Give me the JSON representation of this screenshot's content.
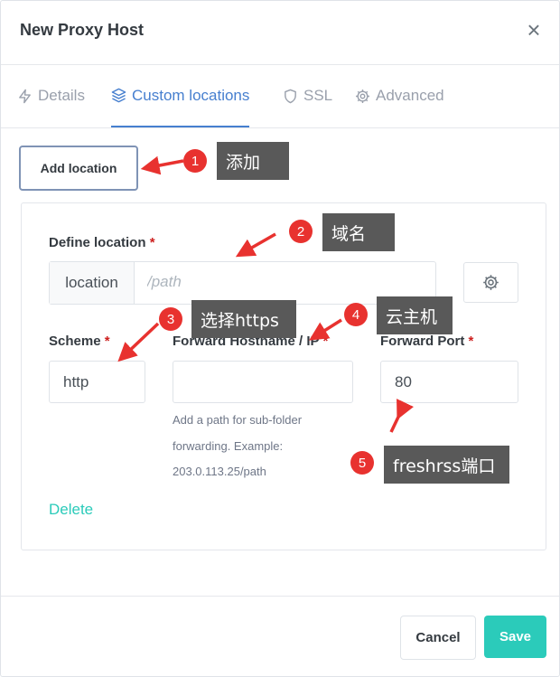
{
  "modal": {
    "title": "New Proxy Host",
    "close_glyph": "×"
  },
  "tabs": [
    {
      "label": "Details",
      "icon": "bolt-icon",
      "active": false
    },
    {
      "label": "Custom locations",
      "icon": "layers-icon",
      "active": true
    },
    {
      "label": "SSL",
      "icon": "shield-icon",
      "active": false
    },
    {
      "label": "Advanced",
      "icon": "gear-icon",
      "active": false
    }
  ],
  "add_location_label": "Add location",
  "location": {
    "define_label": "Define location",
    "required_mark": "*",
    "prefix": "location",
    "placeholder": "/path",
    "value": ""
  },
  "scheme": {
    "label": "Scheme",
    "value": "http"
  },
  "forward_hostname": {
    "label": "Forward Hostname / IP",
    "value": "",
    "help": "Add a path for sub-folder forwarding. Example: 203.0.113.25/path"
  },
  "forward_port": {
    "label": "Forward Port",
    "value": "80"
  },
  "delete_label": "Delete",
  "footer": {
    "cancel_label": "Cancel",
    "save_label": "Save"
  },
  "annotations": [
    {
      "number": "1",
      "text": "添加"
    },
    {
      "number": "2",
      "text": "域名"
    },
    {
      "number": "3",
      "text": "选择https"
    },
    {
      "number": "4",
      "text": "云主机"
    },
    {
      "number": "5",
      "text": "freshrss端口"
    }
  ],
  "colors": {
    "accent": "#467fcf",
    "teal": "#2bcbba",
    "required": "#cd201f",
    "annotation_badge": "#e8322f",
    "annotation_box": "#595959"
  }
}
